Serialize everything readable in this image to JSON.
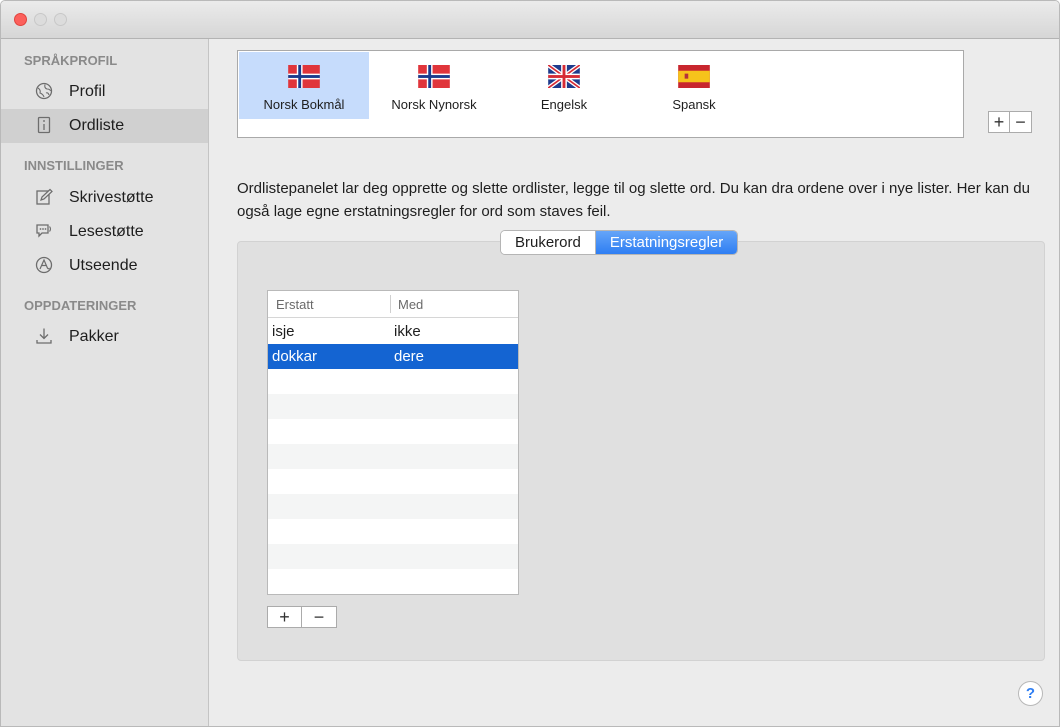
{
  "window": {
    "controls": [
      "close",
      "minimize",
      "zoom"
    ]
  },
  "sidebar": {
    "sections": [
      {
        "title": "SPRÅKPROFIL",
        "items": [
          {
            "label": "Profil",
            "icon": "globe-icon",
            "selected": false
          },
          {
            "label": "Ordliste",
            "icon": "book-icon",
            "selected": true
          }
        ]
      },
      {
        "title": "INNSTILLINGER",
        "items": [
          {
            "label": "Skrivestøtte",
            "icon": "pencil-icon",
            "selected": false
          },
          {
            "label": "Lesestøtte",
            "icon": "speech-icon",
            "selected": false
          },
          {
            "label": "Utseende",
            "icon": "appearance-icon",
            "selected": false
          }
        ]
      },
      {
        "title": "OPPDATERINGER",
        "items": [
          {
            "label": "Pakker",
            "icon": "download-icon",
            "selected": false
          }
        ]
      }
    ]
  },
  "languages": {
    "items": [
      {
        "label": "Norsk Bokmål",
        "flag": "norway-flag-icon",
        "selected": true
      },
      {
        "label": "Norsk Nynorsk",
        "flag": "norway-flag-icon",
        "selected": false
      },
      {
        "label": "Engelsk",
        "flag": "uk-flag-icon",
        "selected": false
      },
      {
        "label": "Spansk",
        "flag": "spain-flag-icon",
        "selected": false
      }
    ],
    "add_label": "+",
    "remove_label": "−"
  },
  "description": "Ordlistepanelet lar deg opprette og slette ordlister, legge til og slette ord. Du kan dra ordene over i nye lister. Her kan du også lage egne erstatningsregler for ord som staves feil.",
  "tabs": [
    {
      "label": "Brukerord",
      "active": false
    },
    {
      "label": "Erstatningsregler",
      "active": true
    }
  ],
  "table": {
    "columns": [
      "Erstatt",
      "Med"
    ],
    "rows": [
      {
        "erstatt": "isje",
        "med": "ikke",
        "selected": false
      },
      {
        "erstatt": "dokkar",
        "med": "dere",
        "selected": true
      }
    ],
    "add_label": "+",
    "remove_label": "−"
  },
  "help_label": "?",
  "colors": {
    "accent": "#2e7ef3",
    "selection": "#1464d2",
    "sidebar_selected": "#d0d0d0",
    "language_selected": "#c6dcfc",
    "close_button": "#fc605c"
  }
}
